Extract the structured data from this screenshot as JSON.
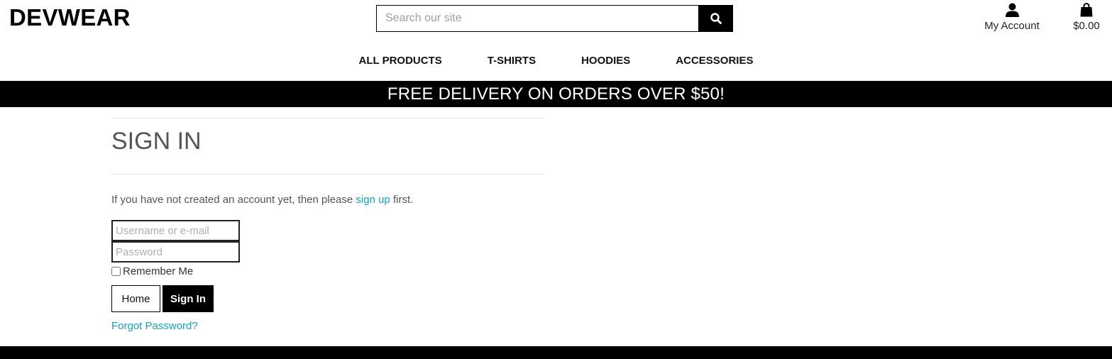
{
  "header": {
    "logo": "DEVWEAR",
    "search_placeholder": "Search our site",
    "search_icon": "search-icon",
    "account_label": "My Account",
    "account_icon": "user-icon",
    "cart_total": "$0.00",
    "cart_icon": "shopping-bag-icon"
  },
  "nav": {
    "items": [
      "ALL PRODUCTS",
      "T-SHIRTS",
      "HOODIES",
      "ACCESSORIES"
    ]
  },
  "banner": {
    "text": "FREE DELIVERY ON ORDERS OVER $50!"
  },
  "signin": {
    "title": "SIGN IN",
    "intro_before": "If you have not created an account yet, then please ",
    "intro_link": "sign up",
    "intro_after": " first.",
    "username_placeholder": "Username or e-mail",
    "password_placeholder": "Password",
    "remember_label": "Remember Me",
    "home_button": "Home",
    "signin_button": "Sign In",
    "forgot_link": "Forgot Password?"
  },
  "colors": {
    "link": "#17a2b8",
    "banner_bg": "#000000",
    "title": "#555555"
  }
}
